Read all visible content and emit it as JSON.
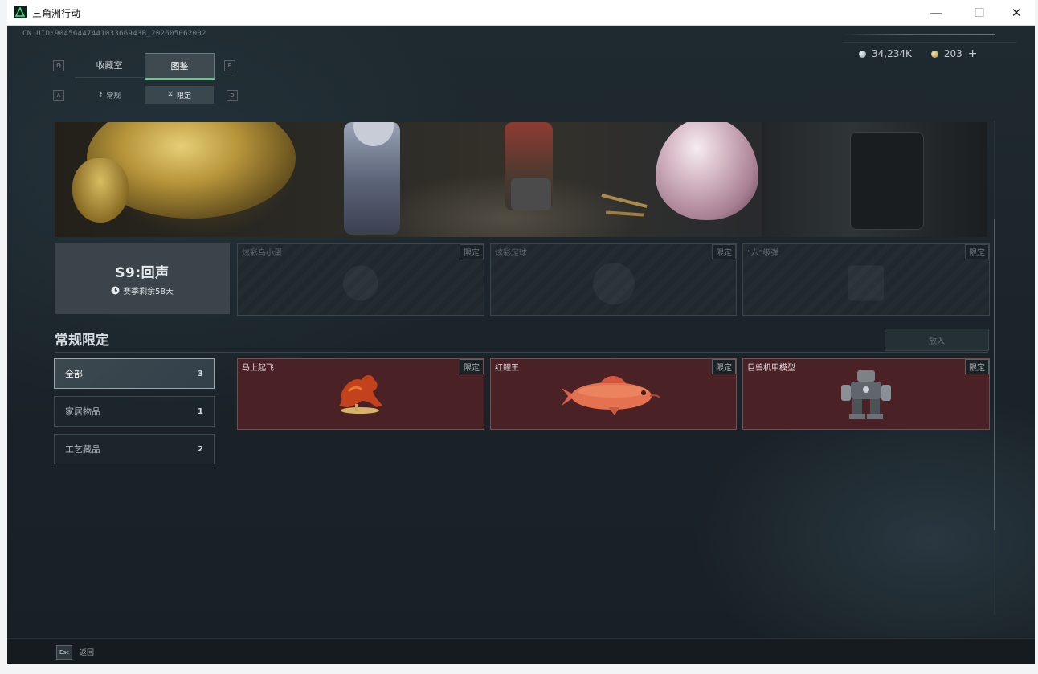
{
  "window": {
    "title": "三角洲行动",
    "minimize": "—",
    "maximize": "☐",
    "close": "✕"
  },
  "uid": "CN UID:9045644744103366943B_202605062002",
  "currency": {
    "silver_amount": "34,234K",
    "gold_amount": "203",
    "add_label": "+"
  },
  "main_tabs": [
    {
      "label": "收藏室",
      "active": false
    },
    {
      "label": "图鉴",
      "active": true
    }
  ],
  "sub_tabs": [
    {
      "label": "常规",
      "icon": "key-icon",
      "active": false
    },
    {
      "label": "限定",
      "icon": "crossed-swords-icon",
      "active": true
    }
  ],
  "hotkeys": {
    "main_left": "Q",
    "main_right": "E",
    "sub_left": "A",
    "sub_right": "D"
  },
  "season": {
    "title": "S9:回声",
    "remaining": "赛季剩余58天",
    "icon": "clock-icon"
  },
  "showcase_slots": [
    {
      "name": "炫彩鸟小蛋",
      "tag": "限定",
      "icon": "bird-icon"
    },
    {
      "name": "炫彩足球",
      "tag": "限定",
      "icon": "football-icon"
    },
    {
      "name": "\"六\"级弹",
      "tag": "限定",
      "icon": "ammo-icon"
    }
  ],
  "section": {
    "title": "常规限定",
    "put_button": "放入"
  },
  "categories": [
    {
      "label": "全部",
      "count": "3",
      "active": true
    },
    {
      "label": "家居物品",
      "count": "1",
      "active": false
    },
    {
      "label": "工艺藏品",
      "count": "2",
      "active": false
    }
  ],
  "items": [
    {
      "name": "马上起飞",
      "tag": "限定",
      "icon": "horse-statue-icon",
      "bg": "#4a2226"
    },
    {
      "name": "红鲤王",
      "tag": "限定",
      "icon": "carp-icon",
      "bg": "#4a2226"
    },
    {
      "name": "巨兽机甲模型",
      "tag": "限定",
      "icon": "mech-model-icon",
      "bg": "#4a2226"
    }
  ],
  "footer": {
    "esc_key": "Esc",
    "back_label": "返回"
  },
  "colors": {
    "accent": "#5fd08b",
    "item_bg": "#4a2226",
    "panel": "#1b2328"
  }
}
